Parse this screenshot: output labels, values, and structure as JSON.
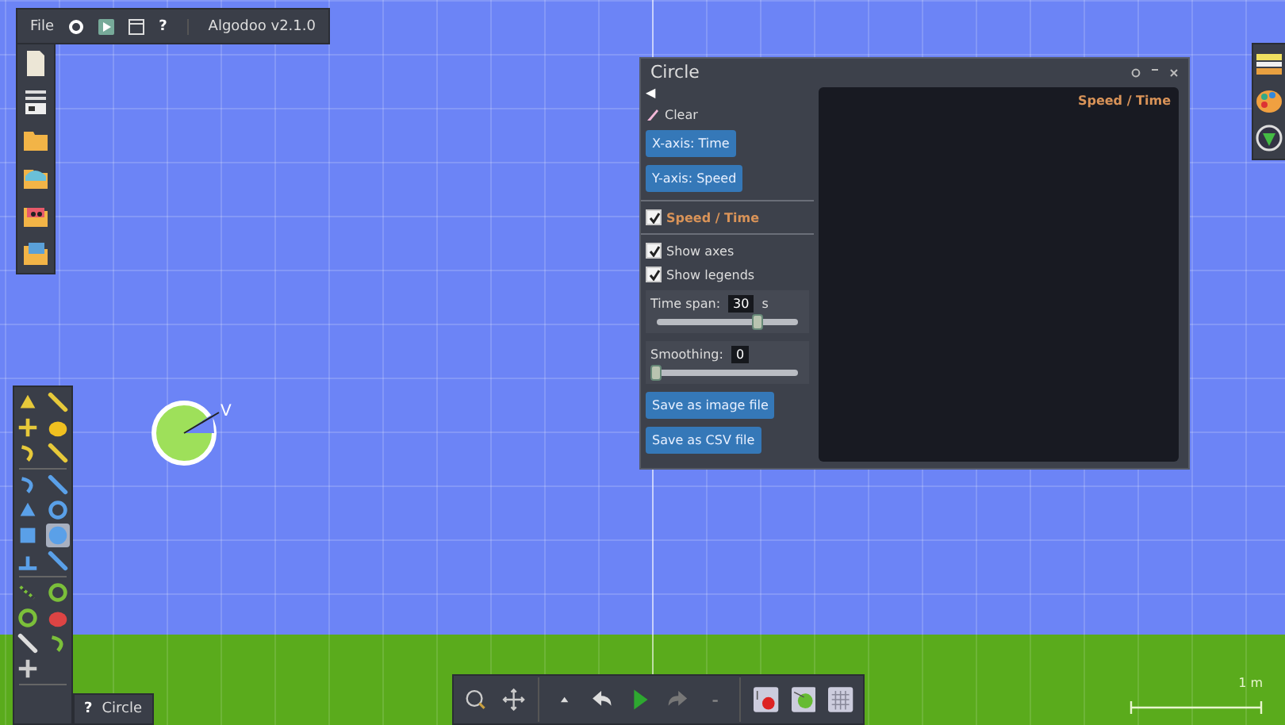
{
  "menu_bar": {
    "file": "File",
    "help": "?",
    "version": "Algodoo v2.1.0"
  },
  "file_toolbar": [
    {
      "kind": "new"
    },
    {
      "kind": "panel"
    },
    {
      "kind": "open"
    },
    {
      "kind": "scene"
    },
    {
      "kind": "phunlet"
    },
    {
      "kind": "blank"
    }
  ],
  "tool_palette": [
    [
      {
        "kind": "sketch",
        "selected": false
      },
      {
        "kind": "cut",
        "selected": false
      },
      {
        "kind": "move",
        "selected": false
      },
      {
        "kind": "drag",
        "selected": false
      },
      {
        "kind": "rotate",
        "selected": false
      },
      {
        "kind": "scale",
        "selected": false
      }
    ],
    [
      {
        "kind": "rope",
        "selected": false
      },
      {
        "kind": "pencil",
        "selected": false
      },
      {
        "kind": "polygon",
        "selected": false
      },
      {
        "kind": "gear",
        "selected": false
      },
      {
        "kind": "box",
        "selected": false
      },
      {
        "kind": "circle",
        "selected": true
      },
      {
        "kind": "plane",
        "selected": false
      },
      {
        "kind": "chain",
        "selected": false
      }
    ],
    [
      {
        "kind": "spring",
        "selected": false
      },
      {
        "kind": "axle",
        "selected": false
      },
      {
        "kind": "fixate",
        "selected": false
      },
      {
        "kind": "tracer",
        "selected": false
      },
      {
        "kind": "thruster",
        "selected": false
      },
      {
        "kind": "hinge",
        "selected": false
      },
      {
        "kind": "laser",
        "selected": false
      }
    ]
  ],
  "selection_label": {
    "help": "?",
    "name": "Circle"
  },
  "scene": {
    "velocity_label": "V",
    "scale": "1 m"
  },
  "plot_window": {
    "title": "Circle",
    "back": "◀",
    "clear": "Clear",
    "x_axis_button": "X-axis: Time",
    "y_axis_button": "Y-axis: Speed",
    "series": [
      {
        "label": "Speed / Time",
        "checked": true
      }
    ],
    "options": [
      {
        "label": "Show axes",
        "checked": true
      },
      {
        "label": "Show legends",
        "checked": true
      }
    ],
    "sliders": [
      {
        "label": "Time span:",
        "value": "30",
        "unit": "s",
        "level": 0.72
      },
      {
        "label": "Smoothing:",
        "value": "0",
        "level": 0
      }
    ],
    "save_buttons": [
      "Save as image file",
      "Save as CSV file"
    ],
    "plot_legend": "Speed / Time"
  },
  "bottom_toolbar": [
    {
      "kind": "zoom"
    },
    {
      "kind": "pan"
    },
    {
      "kind": "sep"
    },
    {
      "kind": "up"
    },
    {
      "kind": "undo"
    },
    {
      "kind": "play"
    },
    {
      "kind": "redo"
    },
    {
      "kind": "down"
    },
    {
      "kind": "sep"
    },
    {
      "kind": "gravity"
    },
    {
      "kind": "air"
    },
    {
      "kind": "grid"
    }
  ],
  "right_toolbar": [
    {
      "kind": "layers"
    },
    {
      "kind": "palette"
    },
    {
      "kind": "options"
    }
  ]
}
